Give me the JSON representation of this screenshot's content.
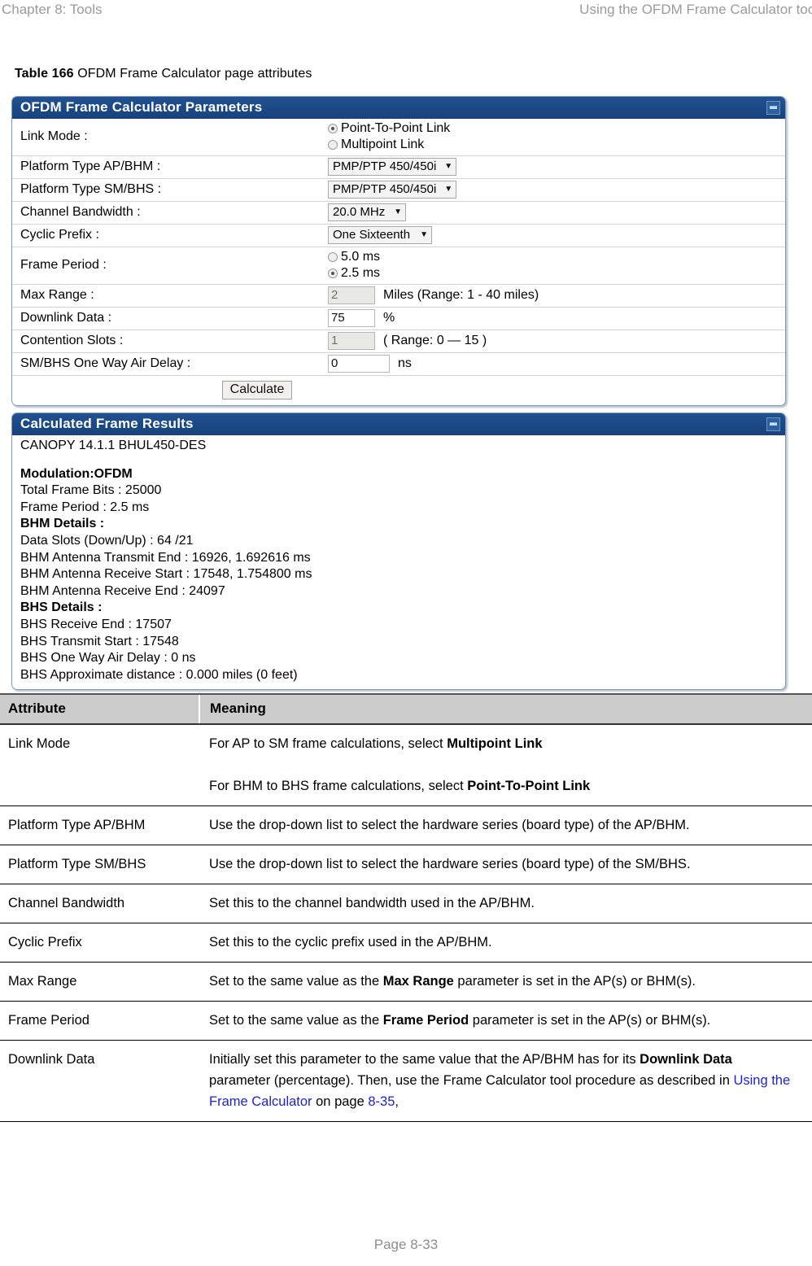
{
  "header": {
    "left": "Chapter 8:  Tools",
    "right": "Using the OFDM Frame Calculator tool"
  },
  "caption": {
    "number": "Table 166",
    "text": " OFDM Frame Calculator page attributes"
  },
  "figure": {
    "params_panel": {
      "title": "OFDM Frame Calculator Parameters",
      "collapse_icon": "minimize-icon",
      "rows": [
        {
          "label": "Link Mode :",
          "type": "radio",
          "options": [
            {
              "label": "Point-To-Point Link",
              "selected": true
            },
            {
              "label": "Multipoint Link",
              "selected": false
            }
          ]
        },
        {
          "label": "Platform Type AP/BHM :",
          "type": "select",
          "value": "PMP/PTP 450/450i"
        },
        {
          "label": "Platform Type SM/BHS :",
          "type": "select",
          "value": "PMP/PTP 450/450i"
        },
        {
          "label": "Channel Bandwidth :",
          "type": "select",
          "value": "20.0 MHz"
        },
        {
          "label": "Cyclic Prefix :",
          "type": "select",
          "value": "One Sixteenth"
        },
        {
          "label": "Frame Period :",
          "type": "radio",
          "options": [
            {
              "label": "5.0 ms",
              "selected": false
            },
            {
              "label": "2.5 ms",
              "selected": true
            }
          ]
        },
        {
          "label": "Max Range :",
          "type": "text",
          "value": "2",
          "readonly": true,
          "unit": "Miles (Range: 1 - 40 miles)"
        },
        {
          "label": "Downlink Data :",
          "type": "text",
          "value": "75",
          "readonly": false,
          "unit": "%"
        },
        {
          "label": "Contention Slots :",
          "type": "text",
          "value": "1",
          "readonly": true,
          "unit": "( Range: 0 — 15 )"
        },
        {
          "label": "SM/BHS One Way Air Delay :",
          "type": "text",
          "value": "0",
          "readonly": false,
          "unit": "ns"
        }
      ],
      "calculate_label": "Calculate"
    },
    "results_panel": {
      "title": "Calculated Frame Results",
      "collapse_icon": "minimize-icon",
      "lines": [
        {
          "text": "CANOPY 14.1.1 BHUL450-DES",
          "bold": false
        },
        {
          "text": "",
          "bold": false
        },
        {
          "text": "Modulation:OFDM",
          "bold": true
        },
        {
          "text": "Total Frame Bits : 25000",
          "bold": false
        },
        {
          "text": "Frame Period : 2.5 ms",
          "bold": false
        },
        {
          "text": "BHM Details :",
          "bold": true
        },
        {
          "text": "Data Slots (Down/Up) : 64 /21",
          "bold": false
        },
        {
          "text": "BHM Antenna Transmit End : 16926, 1.692616 ms",
          "bold": false
        },
        {
          "text": "BHM Antenna Receive Start : 17548, 1.754800 ms",
          "bold": false
        },
        {
          "text": "BHM Antenna Receive End : 24097",
          "bold": false
        },
        {
          "text": "BHS Details :",
          "bold": true
        },
        {
          "text": "BHS Receive End : 17507",
          "bold": false
        },
        {
          "text": "BHS Transmit Start : 17548",
          "bold": false
        },
        {
          "text": "BHS One Way Air Delay : 0 ns",
          "bold": false
        },
        {
          "text": "BHS Approximate distance : 0.000 miles (0 feet)",
          "bold": false
        }
      ]
    }
  },
  "attr_table": {
    "columns": [
      "Attribute",
      "Meaning"
    ],
    "rows": [
      {
        "attribute": "Link Mode",
        "meaning_html": "For AP to SM frame calculations, select <b>Multipoint Link</b><br><br>For BHM to BHS frame calculations, select <b>Point-To-Point Link</b>"
      },
      {
        "attribute": "Platform Type AP/BHM",
        "meaning_html": "Use the drop-down list to select the hardware series (board type) of the AP/BHM."
      },
      {
        "attribute": "Platform Type SM/BHS",
        "meaning_html": "Use the drop-down list to select the hardware series (board type) of the SM/BHS."
      },
      {
        "attribute": "Channel Bandwidth",
        "meaning_html": "Set this to the channel bandwidth used in the AP/BHM."
      },
      {
        "attribute": "Cyclic Prefix",
        "meaning_html": "Set this to the cyclic prefix used in the AP/BHM."
      },
      {
        "attribute": "Max Range",
        "meaning_html": "Set to the same value as the <b>Max Range</b> parameter is set in the AP(s) or BHM(s)."
      },
      {
        "attribute": "Frame Period",
        "meaning_html": "Set to the same value as the <b>Frame Period</b> parameter is set in the AP(s) or BHM(s)."
      },
      {
        "attribute": "Downlink Data",
        "meaning_html": "Initially set this parameter to the same value that the AP/BHM has for its <b>Downlink Data</b> parameter (percentage). Then, use the Frame Calculator tool procedure as described in <span class=\"lnk\">Using the Frame Calculator</span> on page <span class=\"lnk\">8-35</span>,"
      }
    ]
  },
  "footer": {
    "page_label": "Page 8-33"
  },
  "colors": {
    "titlebar": "#1b4a86",
    "panel_border": "#7e9bbd",
    "table_header_bg": "#cccccc",
    "link": "#2020d8",
    "header_text": "#9a9a9a"
  }
}
